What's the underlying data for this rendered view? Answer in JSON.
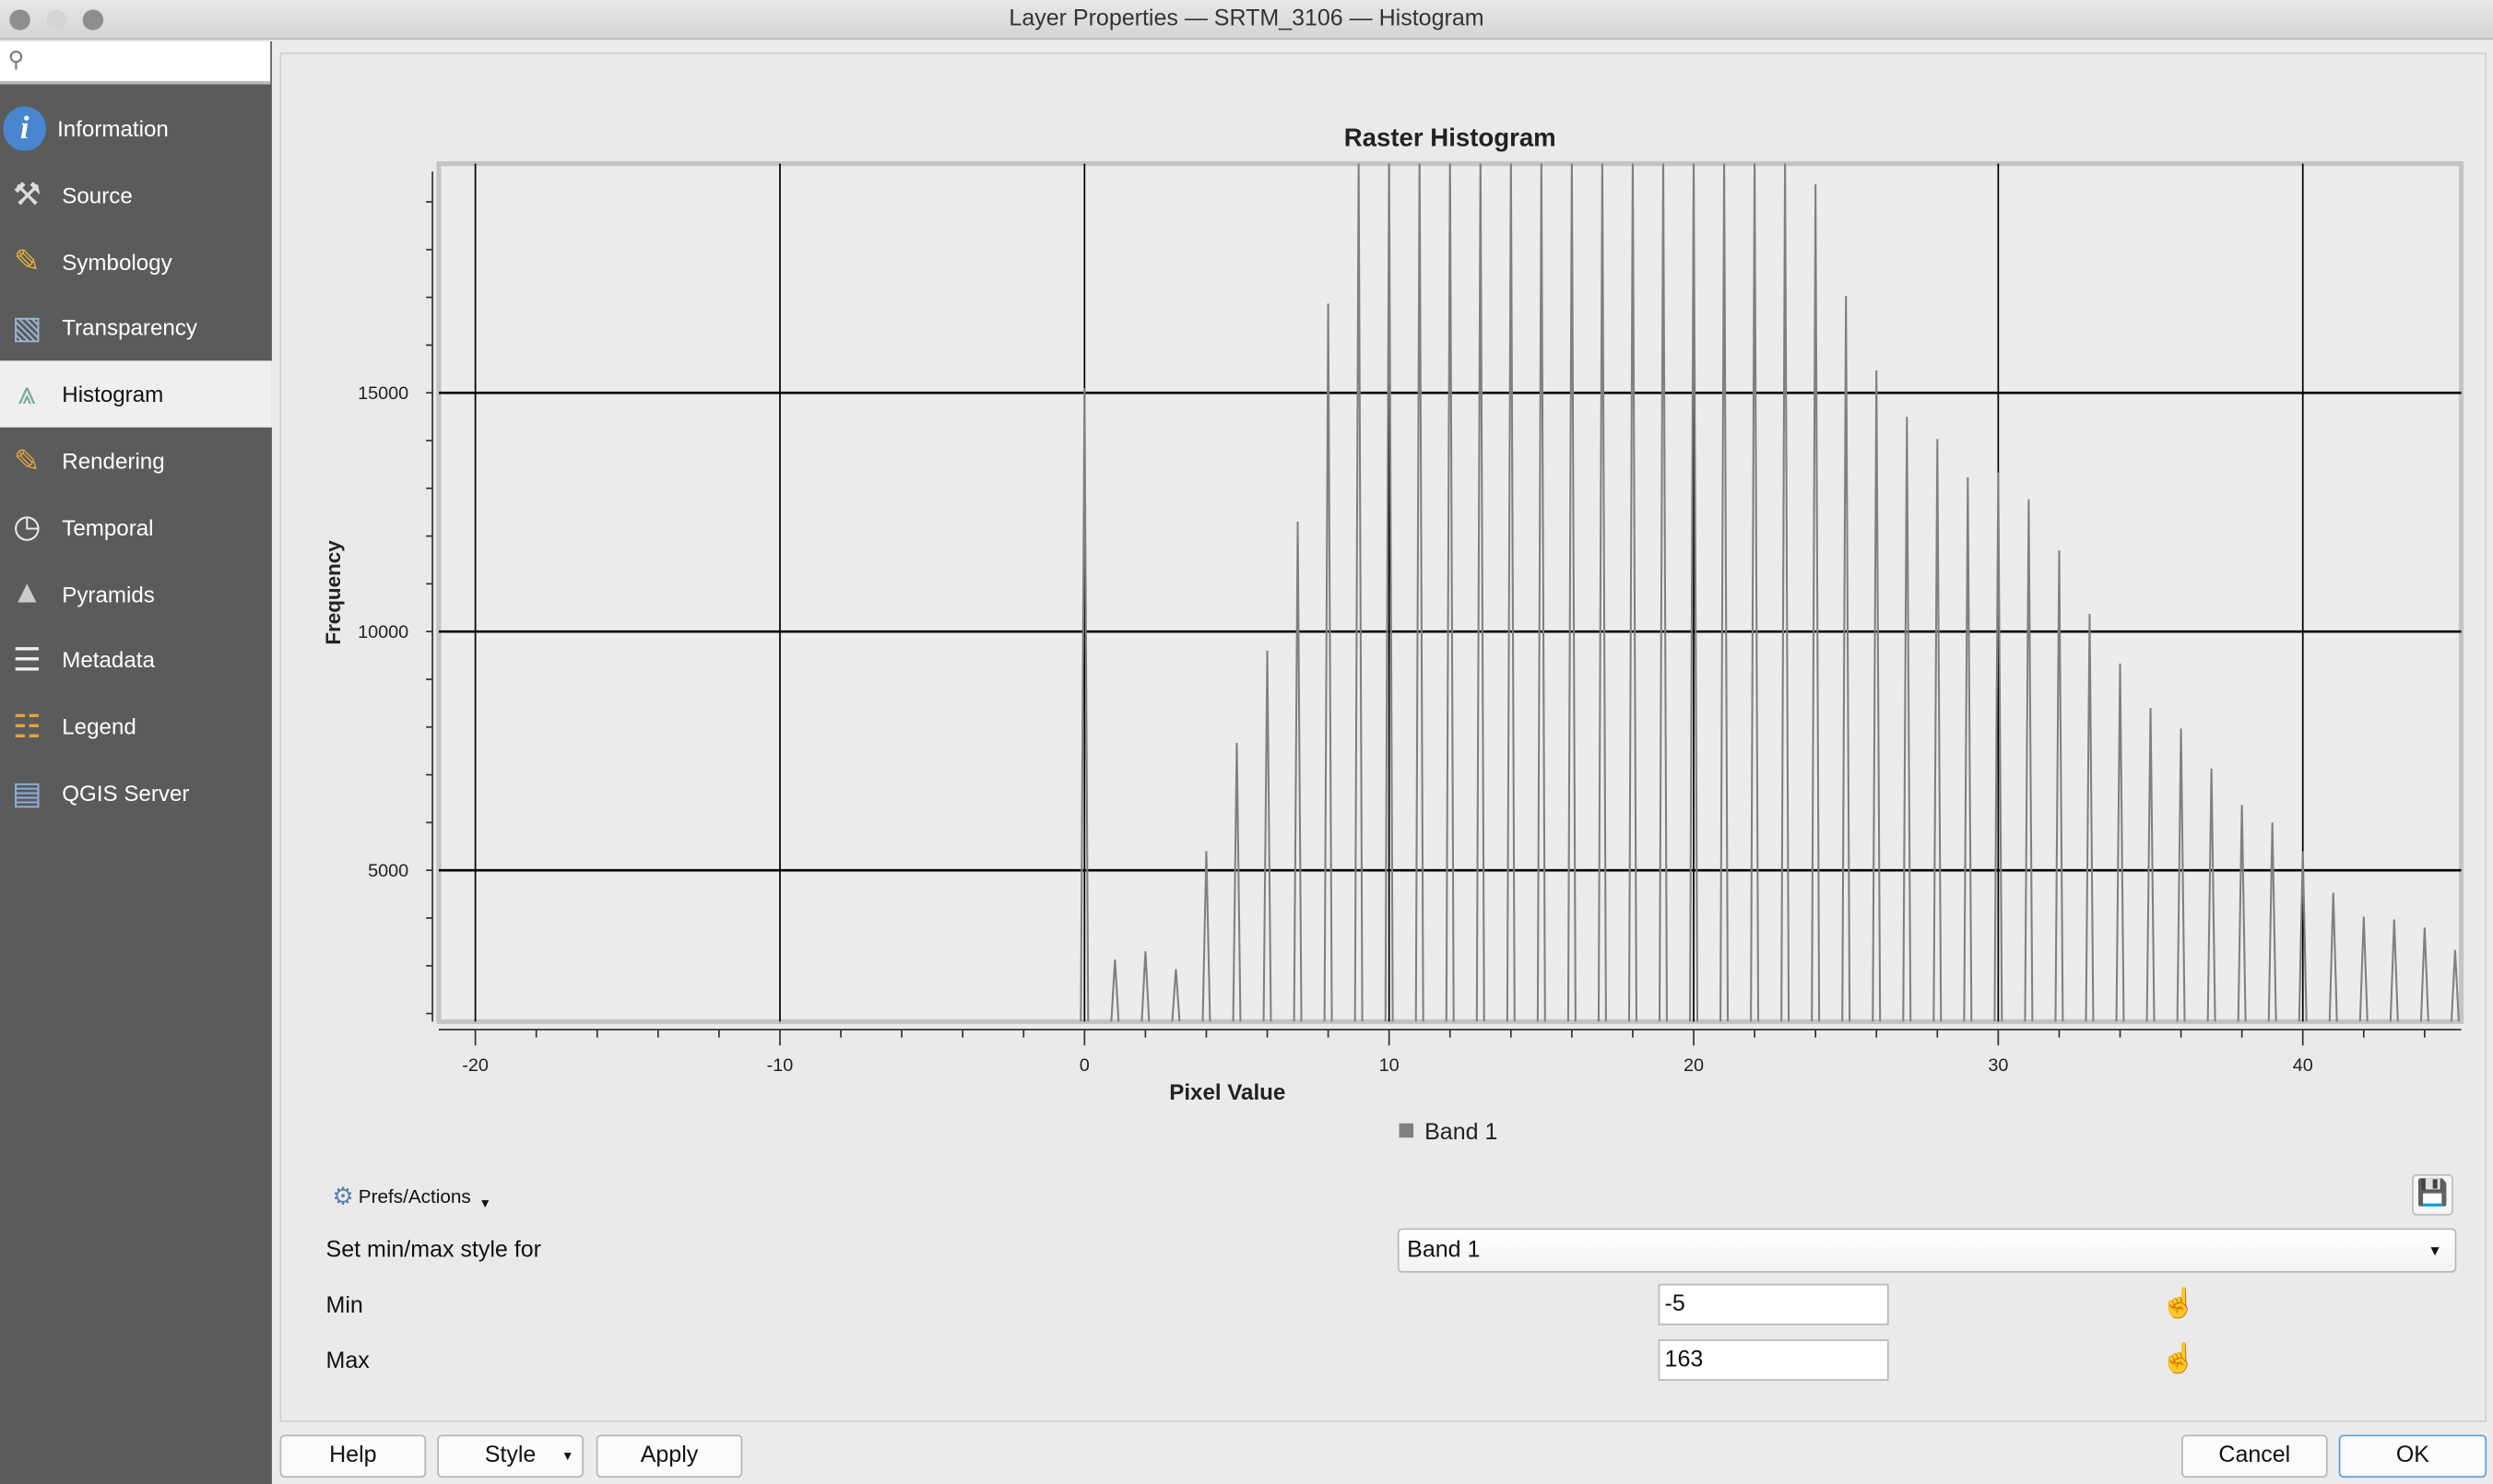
{
  "window": {
    "title": "Layer Properties — SRTM_3106 — Histogram"
  },
  "sidebar": {
    "search_placeholder": "",
    "items": [
      {
        "label": "Information",
        "icon": "info-icon"
      },
      {
        "label": "Source",
        "icon": "source-icon"
      },
      {
        "label": "Symbology",
        "icon": "symbology-icon"
      },
      {
        "label": "Transparency",
        "icon": "transparency-icon"
      },
      {
        "label": "Histogram",
        "icon": "histogram-icon",
        "selected": true
      },
      {
        "label": "Rendering",
        "icon": "rendering-icon"
      },
      {
        "label": "Temporal",
        "icon": "clock-icon"
      },
      {
        "label": "Pyramids",
        "icon": "pyramids-icon"
      },
      {
        "label": "Metadata",
        "icon": "metadata-icon"
      },
      {
        "label": "Legend",
        "icon": "legend-icon"
      },
      {
        "label": "QGIS Server",
        "icon": "server-icon"
      }
    ]
  },
  "chart_data": {
    "type": "line",
    "title": "Raster Histogram",
    "xlabel": "Pixel Value",
    "ylabel": "Frequency",
    "xlim": [
      -21.2,
      45.2
    ],
    "ylim": [
      1830,
      19800
    ],
    "xticks": [
      -20,
      -10,
      0,
      10,
      20,
      30,
      40
    ],
    "yticks": [
      5000,
      10000,
      15000
    ],
    "grid": true,
    "legend_position": "bottom",
    "series": [
      {
        "name": "Band 1",
        "color": "#808080",
        "x": [
          0,
          1,
          2,
          3,
          4,
          5,
          6,
          7,
          8,
          9,
          10,
          11,
          12,
          13,
          14,
          15,
          16,
          17,
          18,
          19,
          20,
          21,
          22,
          23,
          24,
          25,
          26,
          27,
          28,
          29,
          30,
          31,
          32,
          33,
          34,
          35,
          36,
          37,
          38,
          39,
          40,
          41,
          42,
          43,
          44,
          45
        ],
        "values": [
          15100,
          3130,
          3300,
          2930,
          5400,
          7670,
          9600,
          12300,
          16870,
          20000,
          20000,
          20000,
          20000,
          20000,
          20000,
          20000,
          20000,
          20000,
          20000,
          20000,
          20000,
          20000,
          20000,
          20000,
          19370,
          17030,
          15470,
          14500,
          14030,
          13230,
          13330,
          12770,
          11700,
          10370,
          9330,
          8400,
          7970,
          7130,
          6370,
          6000,
          5400,
          4530,
          4030,
          3970,
          3800,
          3330
        ]
      }
    ]
  },
  "controls": {
    "prefs_label": "Prefs/Actions",
    "minmax_label": "Set min/max style for",
    "band_select": "Band 1",
    "min_label": "Min",
    "min_value": "-5",
    "max_label": "Max",
    "max_value": "163"
  },
  "buttons": {
    "help": "Help",
    "style": "Style",
    "apply": "Apply",
    "cancel": "Cancel",
    "ok": "OK"
  }
}
